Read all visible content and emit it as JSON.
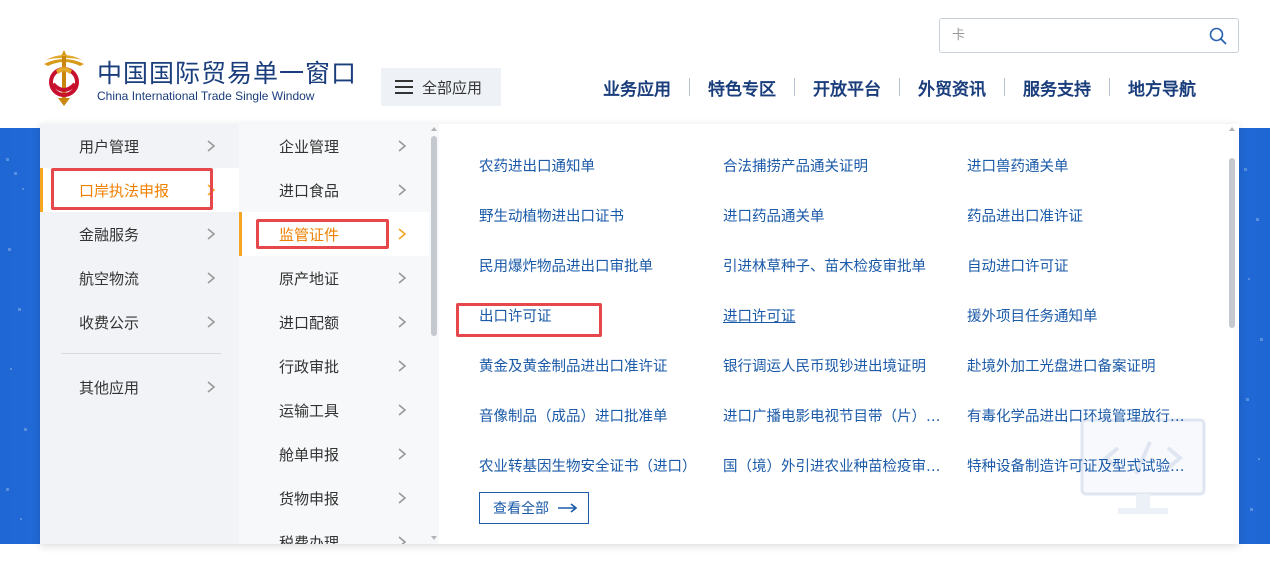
{
  "header": {
    "logo_cn": "中国国际贸易单一窗口",
    "logo_en": "China International Trade Single Window",
    "search_placeholder": "卡",
    "all_apps_label": "全部应用",
    "nav": [
      "业务应用",
      "特色专区",
      "开放平台",
      "外贸资讯",
      "服务支持",
      "地方导航"
    ]
  },
  "menu": {
    "level1": [
      {
        "label": "用户管理",
        "active": false
      },
      {
        "label": "口岸执法申报",
        "active": true
      },
      {
        "label": "金融服务",
        "active": false
      },
      {
        "label": "航空物流",
        "active": false
      },
      {
        "label": "收费公示",
        "active": false
      },
      {
        "label": "其他应用",
        "active": false
      }
    ],
    "level2": [
      {
        "label": "企业管理",
        "active": false
      },
      {
        "label": "进口食品",
        "active": false
      },
      {
        "label": "监管证件",
        "active": true
      },
      {
        "label": "原产地证",
        "active": false
      },
      {
        "label": "进口配额",
        "active": false
      },
      {
        "label": "行政审批",
        "active": false
      },
      {
        "label": "运输工具",
        "active": false
      },
      {
        "label": "舱单申报",
        "active": false
      },
      {
        "label": "货物申报",
        "active": false
      },
      {
        "label": "税费办理",
        "active": false
      }
    ],
    "documents": [
      [
        "农药进出口通知单",
        "合法捕捞产品通关证明",
        "进口兽药通关单"
      ],
      [
        "野生动植物进出口证书",
        "进口药品通关单",
        "药品进出口准许证"
      ],
      [
        "民用爆炸物品进出口审批单",
        "引进林草种子、苗木检疫审批单",
        "自动进口许可证"
      ],
      [
        "出口许可证",
        "进口许可证",
        "援外项目任务通知单"
      ],
      [
        "黄金及黄金制品进出口准许证",
        "银行调运人民币现钞进出境证明",
        "赴境外加工光盘进口备案证明"
      ],
      [
        "音像制品（成品）进口批准单",
        "进口广播电影电视节目带（片）提取单",
        "有毒化学品进出口环境管理放行通知单"
      ],
      [
        "农业转基因生物安全证书（进口）",
        "国（境）外引进农业种苗检疫审批单",
        "特种设备制造许可证及型式试验证书"
      ]
    ],
    "hovered_document": "进口许可证",
    "view_all_label": "查看全部"
  },
  "colors": {
    "brand_blue": "#1a3d7c",
    "link_blue": "#1a5aa8",
    "active_orange": "#f08000",
    "highlight_red": "#e5474b",
    "banner_blue": "#2f86ee"
  }
}
